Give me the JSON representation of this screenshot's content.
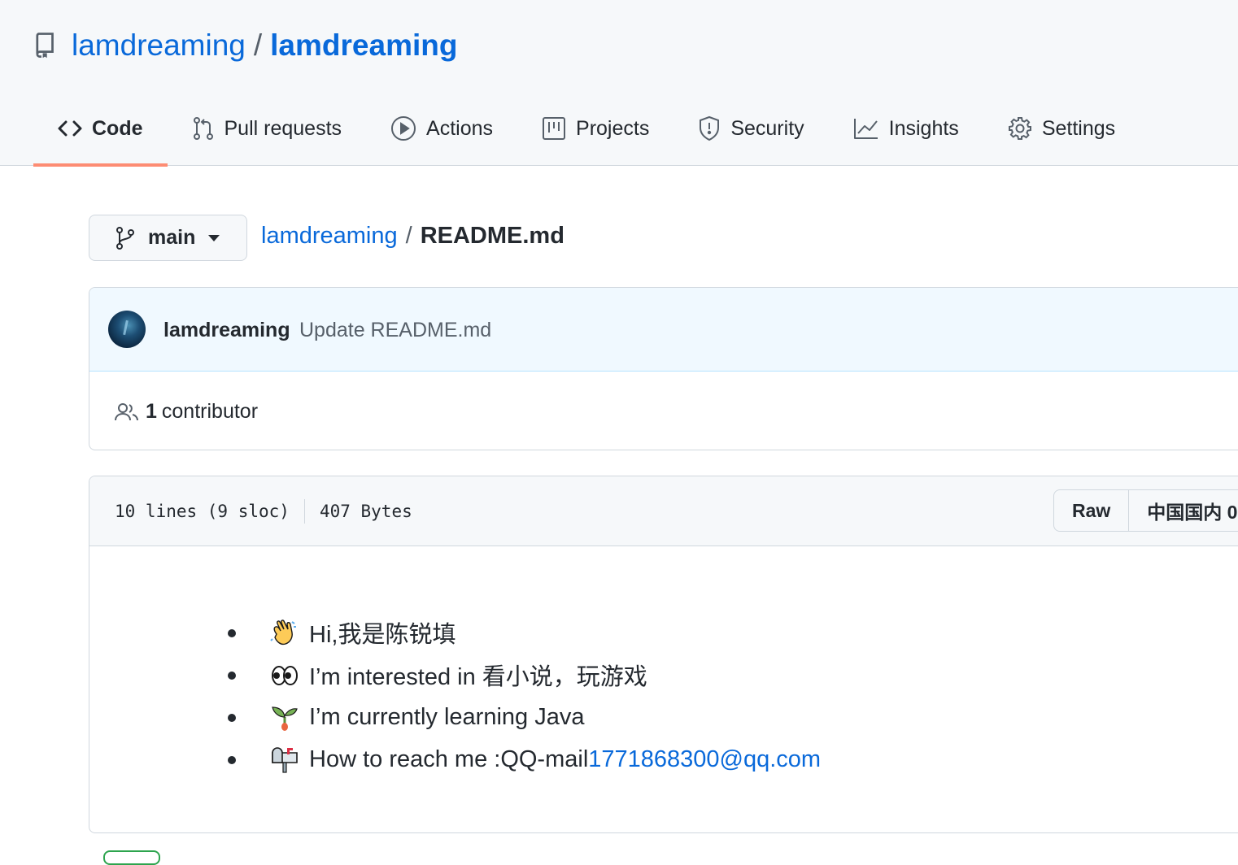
{
  "repo": {
    "owner": "lamdreaming",
    "separator": "/",
    "name": "lamdreaming"
  },
  "tabs": [
    {
      "label": "Code",
      "icon": "code-icon",
      "selected": true
    },
    {
      "label": "Pull requests",
      "icon": "git-pull-request-icon",
      "selected": false
    },
    {
      "label": "Actions",
      "icon": "play-icon",
      "selected": false
    },
    {
      "label": "Projects",
      "icon": "table-icon",
      "selected": false
    },
    {
      "label": "Security",
      "icon": "shield-icon",
      "selected": false
    },
    {
      "label": "Insights",
      "icon": "graph-icon",
      "selected": false
    },
    {
      "label": "Settings",
      "icon": "gear-icon",
      "selected": false
    }
  ],
  "branch": {
    "label": "main"
  },
  "breadcrumb": {
    "repo": "lamdreaming",
    "separator": "/",
    "file": "README.md"
  },
  "commit": {
    "author": "lamdreaming",
    "message": "Update README.md",
    "contributors_count": "1",
    "contributors_label": "contributor"
  },
  "file": {
    "lines": "10 lines (9 sloc)",
    "size": "407 Bytes",
    "raw_label": "Raw",
    "second_button_label": "中国国内 0"
  },
  "readme": {
    "items": [
      {
        "emoji": "waving-hand",
        "text": "Hi,我是陈锐填"
      },
      {
        "emoji": "eyes",
        "text": "I’m interested in 看小说，玩游戏"
      },
      {
        "emoji": "seedling",
        "text": "I’m currently learning Java"
      },
      {
        "emoji": "mailbox",
        "text": "How to reach me :QQ-mail ",
        "link": "1771868300@qq.com"
      }
    ]
  },
  "colors": {
    "link": "#0969da",
    "tab_underline": "#fd8c73",
    "commit_bg": "#f0f9ff"
  }
}
